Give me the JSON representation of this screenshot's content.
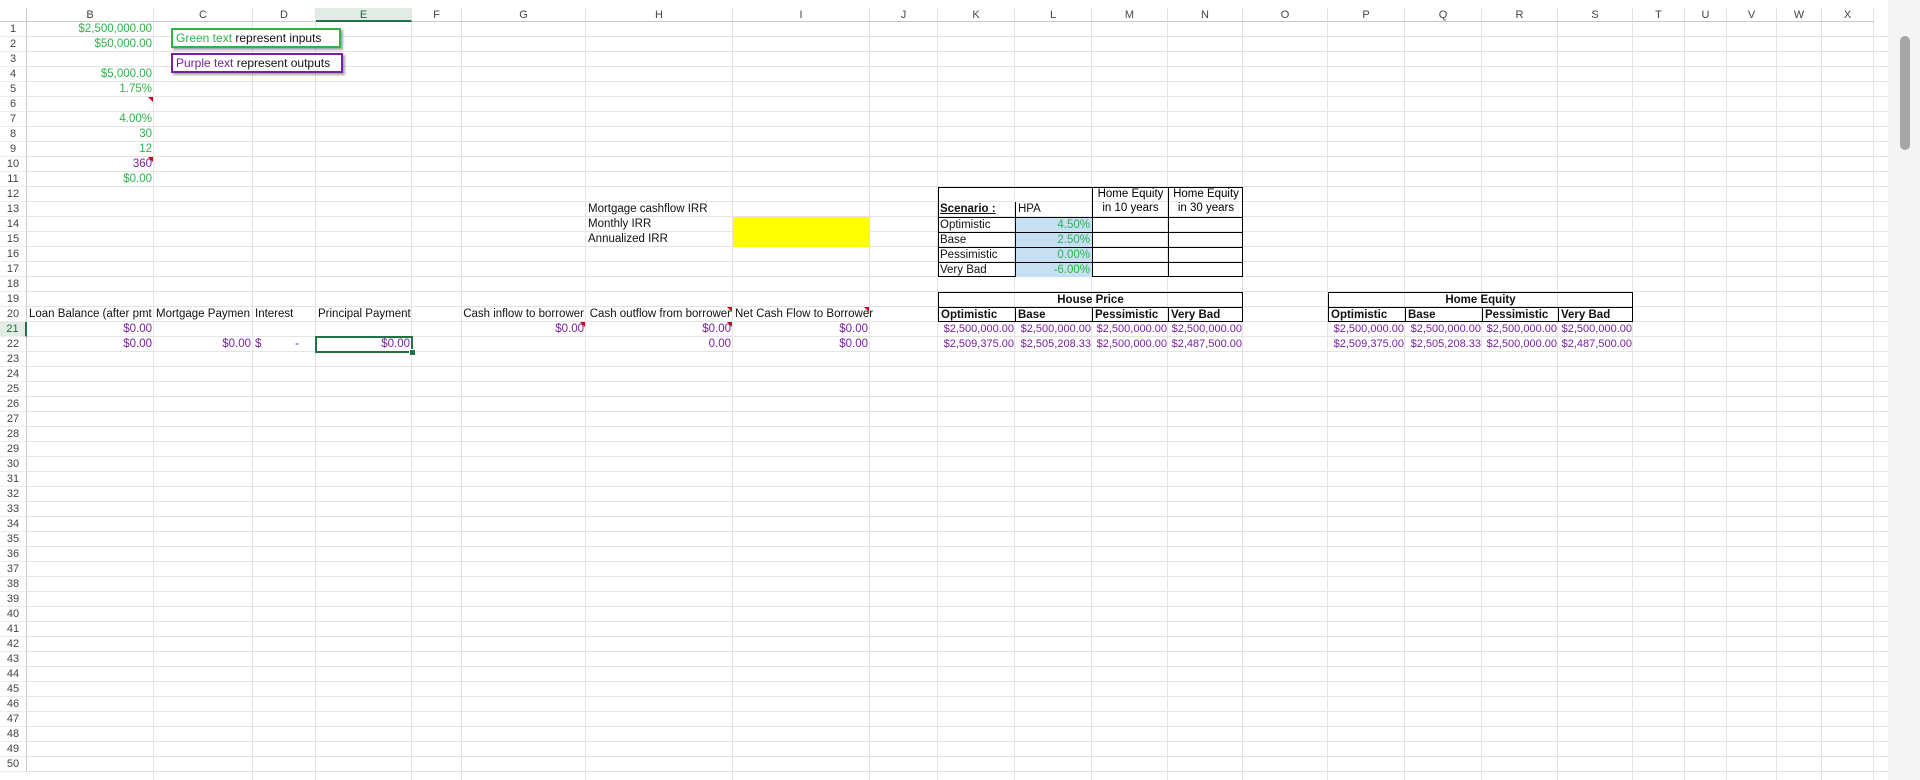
{
  "columns": [
    "B",
    "C",
    "D",
    "E",
    "F",
    "G",
    "H",
    "I",
    "J",
    "K",
    "L",
    "M",
    "N",
    "O",
    "P",
    "Q",
    "R",
    "S",
    "T",
    "U",
    "V",
    "W",
    "X"
  ],
  "selected_column": "E",
  "selected_row": "21",
  "rows": [
    "1",
    "2",
    "3",
    "4",
    "5",
    "6",
    "7",
    "8",
    "9",
    "10",
    "11",
    "12",
    "13",
    "14",
    "15",
    "16",
    "17",
    "18",
    "19",
    "20",
    "21",
    "22",
    "23",
    "24",
    "25",
    "26",
    "27",
    "28",
    "29",
    "30",
    "31",
    "32",
    "33",
    "34",
    "35",
    "36",
    "37",
    "38",
    "39",
    "40",
    "41",
    "42",
    "43",
    "44",
    "45",
    "46",
    "47",
    "48",
    "49",
    "50"
  ],
  "inputs": {
    "b1": "$2,500,000.00",
    "b2": "$50,000.00",
    "b4": "$5,000.00",
    "b5": "1.75%",
    "b7": "4.00%",
    "b8": "30",
    "b9": "12",
    "b10": "360",
    "b11": "$0.00"
  },
  "legend": {
    "green_word": "Green text",
    "green_rest": " represent inputs",
    "purple_word": "Purple text",
    "purple_rest": " represent outputs"
  },
  "irr": {
    "mortgage_label": "Mortgage cashflow IRR",
    "monthly_label": "Monthly IRR",
    "annualized_label": "Annualized IRR"
  },
  "cashflow_table": {
    "headers": {
      "b": "Loan Balance (after pmt",
      "c": "Mortgage Paymen",
      "d": "Interest",
      "e": "Principal Payment",
      "g": "Cash inflow to borrower",
      "h": "Cash outflow from borrower",
      "i": "Net Cash Flow to Borrower"
    },
    "row20": {
      "b": "$0.00",
      "g": "$0.00",
      "h": "$0.00",
      "i": "$0.00"
    },
    "row21": {
      "b": "$0.00",
      "c": "$0.00",
      "d_sym": "$",
      "d_val": "-",
      "e": "$0.00",
      "h": "0.00",
      "i": "$0.00"
    }
  },
  "scenario_table": {
    "header_scenario": "Scenario :",
    "header_hpa": "HPA",
    "header_eq10_line1": "Home Equity",
    "header_eq10_line2": "in 10 years",
    "header_eq30_line1": "Home Equity",
    "header_eq30_line2": "in 30 years",
    "rows": [
      {
        "name": "Optimistic",
        "hpa": "4.50%"
      },
      {
        "name": "Base",
        "hpa": "2.50%"
      },
      {
        "name": "Pessimistic",
        "hpa": "0.00%"
      },
      {
        "name": "Very Bad",
        "hpa": "-6.00%"
      }
    ]
  },
  "house_price": {
    "title": "House Price",
    "headers": [
      "Optimistic",
      "Base",
      "Pessimistic",
      "Very Bad"
    ],
    "row1": [
      "$2,500,000.00",
      "$2,500,000.00",
      "$2,500,000.00",
      "$2,500,000.00"
    ],
    "row2": [
      "$2,509,375.00",
      "$2,505,208.33",
      "$2,500,000.00",
      "$2,487,500.00"
    ]
  },
  "home_equity": {
    "title": "Home Equity",
    "headers": [
      "Optimistic",
      "Base",
      "Pessimistic",
      "Very Bad"
    ],
    "row1": [
      "$2,500,000.00",
      "$2,500,000.00",
      "$2,500,000.00",
      "$2,500,000.00"
    ],
    "row2": [
      "$2,509,375.00",
      "$2,505,208.33",
      "$2,500,000.00",
      "$2,487,500.00"
    ]
  },
  "colors": {
    "input_green": "#2db34a",
    "output_purple": "#7a1fa2",
    "accent": "#217346",
    "hpa_fill": "#c6dff3",
    "irr_fill": "#ffff00"
  }
}
